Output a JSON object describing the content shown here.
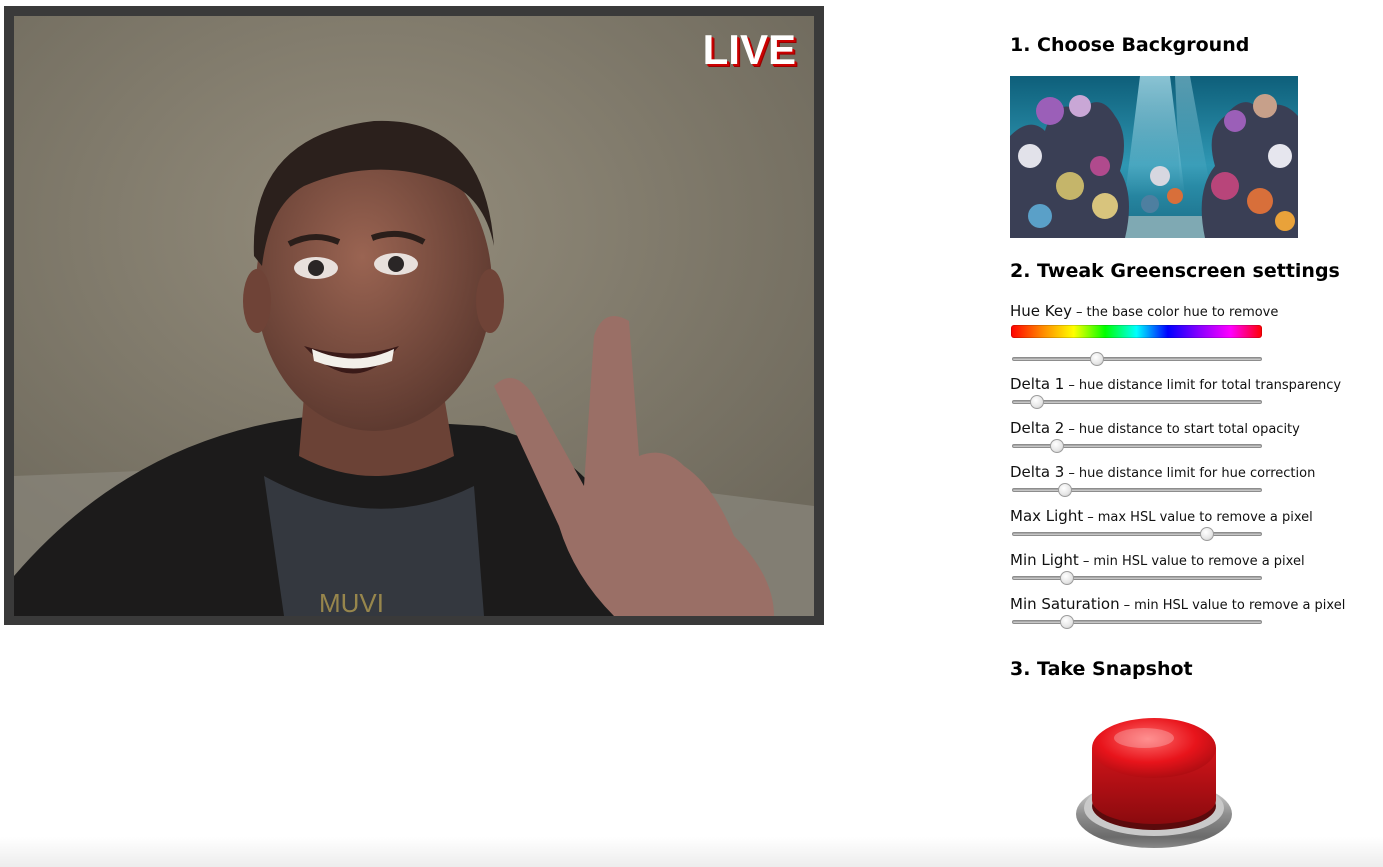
{
  "video": {
    "live_label": "LIVE"
  },
  "steps": {
    "choose_background": "1. Choose Background",
    "tweak_settings": "2. Tweak Greenscreen settings",
    "take_snapshot": "3. Take Snapshot"
  },
  "background": {
    "icon": "coral-reef-image"
  },
  "settings": [
    {
      "name": "Hue Key",
      "desc": "the base color hue to remove",
      "value": 0.34,
      "has_hue_bar": true
    },
    {
      "name": "Delta 1",
      "desc": "hue distance limit for total transparency",
      "value": 0.1
    },
    {
      "name": "Delta 2",
      "desc": "hue distance to start total opacity",
      "value": 0.18
    },
    {
      "name": "Delta 3",
      "desc": "hue distance limit for hue correction",
      "value": 0.21
    },
    {
      "name": "Max Light",
      "desc": "max HSL value to remove a pixel",
      "value": 0.78
    },
    {
      "name": "Min Light",
      "desc": "min HSL value to remove a pixel",
      "value": 0.22
    },
    {
      "name": "Min Saturation",
      "desc": "min HSL value to remove a pixel",
      "value": 0.22
    }
  ],
  "snapshot": {
    "icon": "red-push-button-icon"
  },
  "separator": "–",
  "colors": {
    "frame": "#3a3a3a",
    "live_text": "#ffffff",
    "live_shadow": "#cc0000",
    "button_red": "#e8141b"
  }
}
